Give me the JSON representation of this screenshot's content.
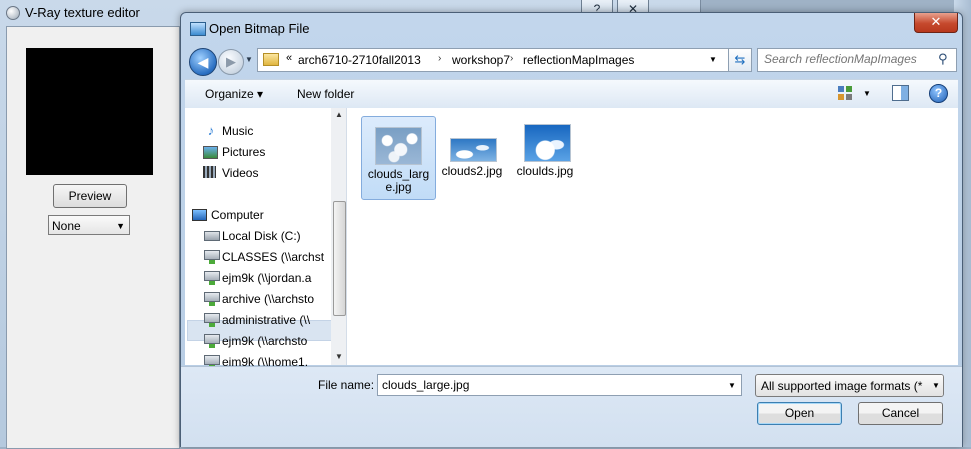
{
  "vray": {
    "title": "V-Ray texture editor",
    "help_button": "?",
    "close_button": "✕",
    "preview_button": "Preview",
    "mapping_select": "None"
  },
  "dialog": {
    "title": "Open Bitmap File",
    "close": "✕",
    "address": {
      "overflow": "«",
      "breadcrumbs": [
        "arch6710-2710fall2013",
        "workshop7",
        "reflectionMapImages"
      ],
      "separator": "›"
    },
    "search": {
      "placeholder": "Search reflectionMapImages"
    },
    "toolbar": {
      "organize": "Organize ▾",
      "new_folder": "New folder",
      "help": "?"
    },
    "nav": {
      "items": [
        {
          "label": "Music",
          "icon": "music-icon"
        },
        {
          "label": "Pictures",
          "icon": "pictures-icon"
        },
        {
          "label": "Videos",
          "icon": "videos-icon"
        },
        {
          "label": "Computer",
          "icon": "computer-icon"
        },
        {
          "label": "Local Disk (C:)",
          "icon": "local-disk-icon"
        },
        {
          "label": "CLASSES (\\\\archst",
          "icon": "network-drive-icon"
        },
        {
          "label": "ejm9k (\\\\jordan.a",
          "icon": "network-drive-icon"
        },
        {
          "label": "archive (\\\\archsto",
          "icon": "network-drive-icon"
        },
        {
          "label": "administrative (\\\\",
          "icon": "network-drive-icon"
        },
        {
          "label": "ejm9k (\\\\archsto",
          "icon": "network-drive-icon"
        },
        {
          "label": "ejm9k (\\\\home1.",
          "icon": "network-drive-icon"
        }
      ],
      "selected_index": 9
    },
    "files": [
      {
        "name_line1": "clouds_larg",
        "name_line2": "e.jpg",
        "selected": true
      },
      {
        "name_line1": "clouds2.jpg",
        "name_line2": "",
        "selected": false
      },
      {
        "name_line1": "cloulds.jpg",
        "name_line2": "",
        "selected": false
      }
    ],
    "file_name_label": "File name:",
    "file_name_value": "clouds_large.jpg",
    "file_type": "All supported image formats (*",
    "open_button": "Open",
    "cancel_button": "Cancel"
  },
  "colors": {
    "selection": "#cfe3fc",
    "accent": "#2a6fc2",
    "close_red": "#c6492d"
  }
}
